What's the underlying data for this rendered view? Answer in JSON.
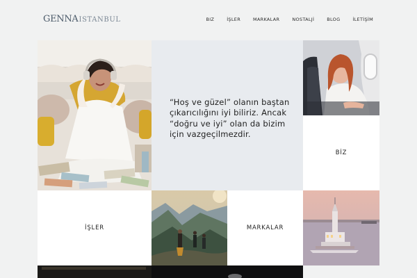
{
  "brand": {
    "name_part1": "GENNA",
    "name_part2": "ISTANBUL"
  },
  "nav": {
    "items": [
      {
        "label": "BIZ"
      },
      {
        "label": "İŞLER"
      },
      {
        "label": "MARKALAR"
      },
      {
        "label": "NOSTALJİ"
      },
      {
        "label": "BLOG"
      },
      {
        "label": "İLETİŞİM"
      }
    ]
  },
  "hero": {
    "quote": "“Hoş ve güzel” olanın baştan çıkarıcılığını iyi biliriz. Ancak “doğru ve iyi” olan da bizim için vazgeçilmezdir."
  },
  "tiles": {
    "biz": "BİZ",
    "isler": "İŞLER",
    "markalar": "MARKALAR"
  },
  "colors": {
    "page_bg": "#f1f2f2",
    "quote_bg": "#e8ebef",
    "tile_bg": "#ffffff",
    "logo": "#4b5a69"
  }
}
